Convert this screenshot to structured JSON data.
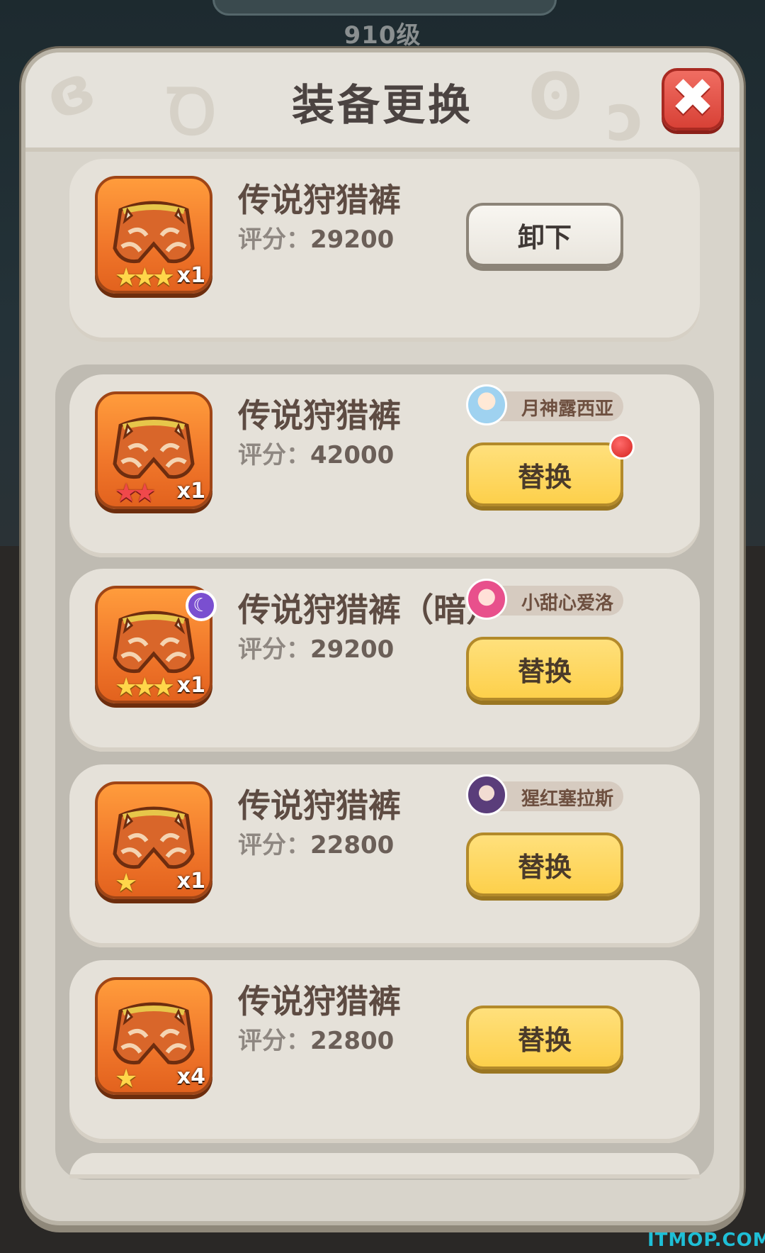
{
  "background": {
    "level_text": "910级"
  },
  "dialog": {
    "title": "装备更换",
    "close_icon": "close-icon"
  },
  "score_label": "评分：",
  "equipped": {
    "name": "传说狩猎裤",
    "score": "29200",
    "stars": 3,
    "star_color": "gold",
    "qty": "x1",
    "button": "卸下"
  },
  "items": [
    {
      "name": "传说狩猎裤",
      "score": "42000",
      "stars": 2,
      "star_color": "red",
      "qty": "x1",
      "owner": "月神露西亚",
      "button": "替换",
      "has_notification": true,
      "badge": ""
    },
    {
      "name": "传说狩猎裤（暗）",
      "score": "29200",
      "stars": 3,
      "star_color": "gold",
      "qty": "x1",
      "owner": "小甜心爱洛",
      "button": "替换",
      "has_notification": false,
      "badge": "moon-icon"
    },
    {
      "name": "传说狩猎裤",
      "score": "22800",
      "stars": 1,
      "star_color": "gold",
      "qty": "x1",
      "owner": "猩红塞拉斯",
      "button": "替换",
      "has_notification": false,
      "badge": ""
    },
    {
      "name": "传说狩猎裤",
      "score": "22800",
      "stars": 1,
      "star_color": "gold",
      "qty": "x4",
      "owner": "",
      "button": "替换",
      "has_notification": false,
      "badge": ""
    }
  ],
  "colors": {
    "accent_yellow": "#fdd04b",
    "close_red": "#e0493d",
    "notification_red": "#d5231f"
  },
  "watermark": "ITMOP.COM"
}
